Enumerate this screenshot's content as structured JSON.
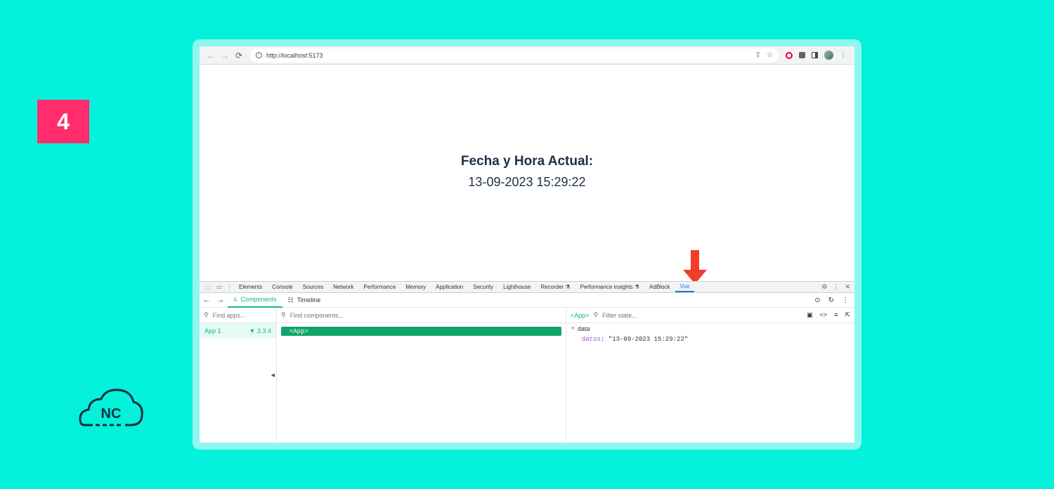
{
  "step": "4",
  "logo": {
    "text": "NC"
  },
  "browser": {
    "url": "http://localhost:5173"
  },
  "page": {
    "heading": "Fecha y Hora Actual:",
    "datetime": "13-09-2023 15:29:22"
  },
  "devtools": {
    "tabs": [
      "Elements",
      "Console",
      "Sources",
      "Network",
      "Performance",
      "Memory",
      "Application",
      "Security",
      "Lighthouse",
      "Recorder ⚗",
      "Performance insights ⚗",
      "AdBlock",
      "Vue"
    ],
    "active_tab": "Vue"
  },
  "vue": {
    "tab_components": "Components",
    "tab_timeline": "Timeline",
    "find_apps_placeholder": "Find apps...",
    "find_components_placeholder": "Find components...",
    "filter_state_placeholder": "Filter state...",
    "app_name": "App 1",
    "app_version": "3.3.4",
    "selected_component": "<App>",
    "state_component": "<App>",
    "section": "data",
    "prop_key": "datos",
    "prop_value": "\"13-09-2023 15:29:22\""
  },
  "colors": {
    "background": "#04f1dc",
    "badge": "#ff2d6b",
    "vue_green": "#10b981",
    "arrow": "#f23b2d"
  }
}
